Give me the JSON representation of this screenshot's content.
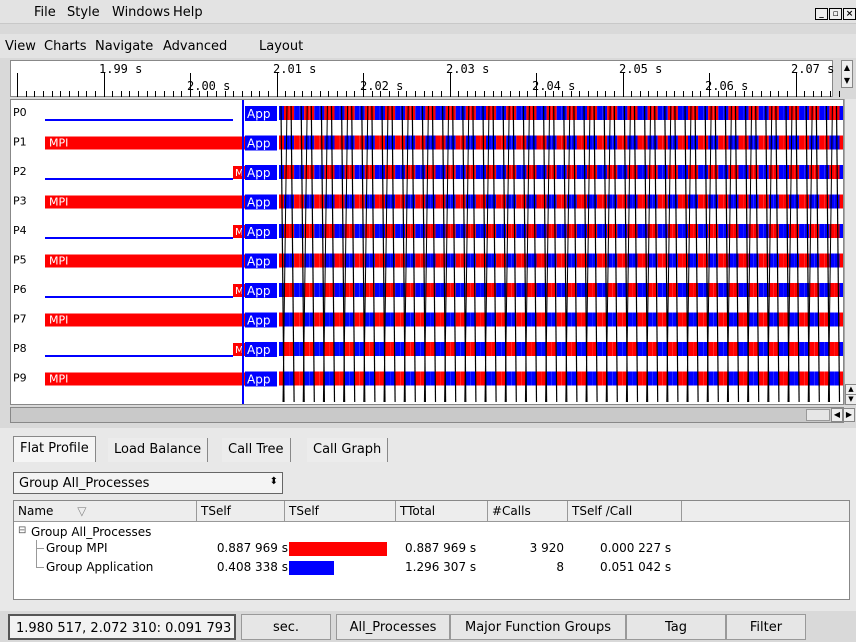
{
  "menubar_top": {
    "items": [
      "File",
      "Style",
      "Windows",
      "Help"
    ],
    "window_controls": [
      "minimize-icon",
      "restore-icon",
      "close-icon"
    ]
  },
  "menubar_second": {
    "items": [
      "View",
      "Charts",
      "Navigate",
      "Advanced",
      "Layout"
    ]
  },
  "ruler": {
    "upper_labels": [
      "1.99 s",
      "2.01 s",
      "2.03 s",
      "2.05 s",
      "2.07 s"
    ],
    "lower_labels": [
      "2.00 s",
      "2.02 s",
      "2.04 s",
      "2.06 s"
    ]
  },
  "timeline": {
    "processes": [
      {
        "label": "P0",
        "pre_state": "line",
        "short_label": "",
        "app_label": "App"
      },
      {
        "label": "P1",
        "pre_state": "MPI",
        "short_label": "MPI",
        "app_label": "App"
      },
      {
        "label": "P2",
        "pre_state": "line",
        "short_label": "M",
        "app_label": "App"
      },
      {
        "label": "P3",
        "pre_state": "MPI",
        "short_label": "MPI",
        "app_label": "App"
      },
      {
        "label": "P4",
        "pre_state": "line",
        "short_label": "M",
        "app_label": "App"
      },
      {
        "label": "P5",
        "pre_state": "MPI",
        "short_label": "MPI",
        "app_label": "App"
      },
      {
        "label": "P6",
        "pre_state": "line",
        "short_label": "M",
        "app_label": "App"
      },
      {
        "label": "P7",
        "pre_state": "MPI",
        "short_label": "MPI",
        "app_label": "App"
      },
      {
        "label": "P8",
        "pre_state": "line",
        "short_label": "M",
        "app_label": "App"
      },
      {
        "label": "P9",
        "pre_state": "MPI",
        "short_label": "MPI",
        "app_label": "App"
      }
    ],
    "colors": {
      "mpi": "#ff0000",
      "app": "#0000ff",
      "message": "#000000"
    }
  },
  "tabs": [
    "Flat Profile",
    "Load Balance",
    "Call Tree",
    "Call Graph"
  ],
  "active_tab": "Flat Profile",
  "group_select": {
    "value": "Group All_Processes"
  },
  "table": {
    "headers": [
      "Name",
      "TSelf",
      "TSelf",
      "TTotal",
      "#Calls",
      "TSelf /Call"
    ],
    "root": "Group All_Processes",
    "rows": [
      {
        "name": "Group MPI",
        "tself": "0.887 969 s",
        "tself_fraction": 1.0,
        "color": "#ff0000",
        "ttotal": "0.887 969 s",
        "calls": "3 920",
        "tself_per_call": "0.000 227 s"
      },
      {
        "name": "Group Application",
        "tself": "0.408 338 s",
        "tself_fraction": 0.46,
        "color": "#0000ff",
        "ttotal": "1.296 307 s",
        "calls": "8",
        "tself_per_call": "0.051 042 s"
      }
    ]
  },
  "statusbar": {
    "range": "1.980 517, 2.072 310: 0.091 793",
    "unit": "sec.",
    "processes": "All_Processes",
    "grouping": "Major Function Groups",
    "tag": "Tag",
    "filter": "Filter"
  }
}
